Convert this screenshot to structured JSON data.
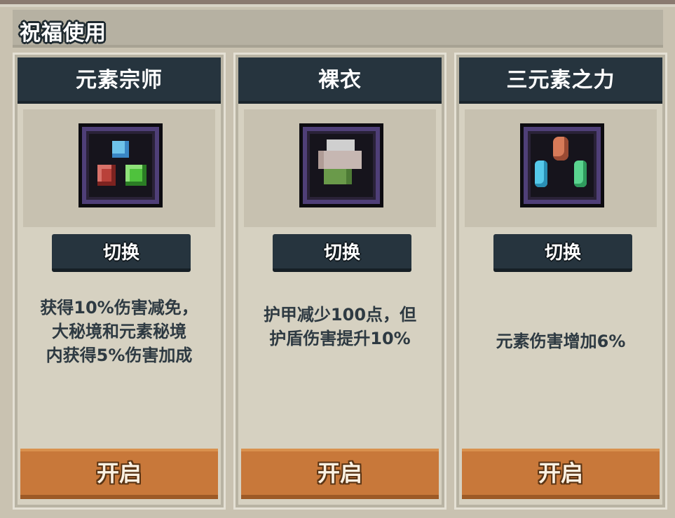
{
  "header": {
    "title": "祝福使用"
  },
  "panels": [
    {
      "title": "元素宗师",
      "icon": "element-master-icon",
      "switch_label": "切换",
      "description": [
        "获得10%伤害减免，",
        "大秘境和元素秘境",
        "内获得5%伤害加成"
      ],
      "open_label": "开启"
    },
    {
      "title": "裸衣",
      "icon": "naked-cloth-icon",
      "switch_label": "切换",
      "description": [
        "护甲减少100点，但",
        "护盾伤害提升10%"
      ],
      "open_label": "开启"
    },
    {
      "title": "三元素之力",
      "icon": "three-elements-icon",
      "switch_label": "切换",
      "description": [
        "元素伤害增加6%"
      ],
      "open_label": "开启"
    }
  ]
}
